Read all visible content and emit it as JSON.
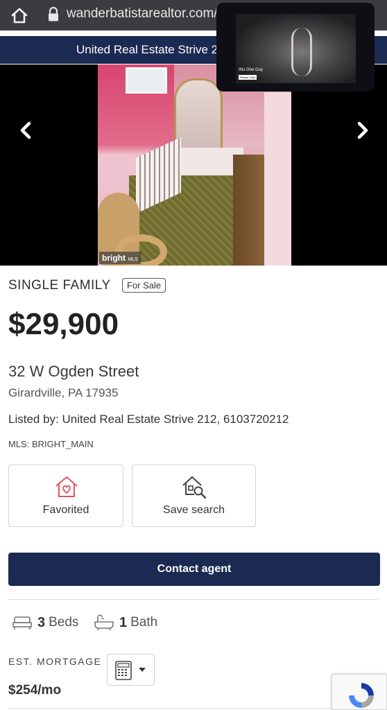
{
  "browser": {
    "url": "wanderbatistarealtor.com/"
  },
  "banner": {
    "text": "United Real Estate Strive 21"
  },
  "carousel": {
    "watermark": "bright",
    "watermark_sub": "MLS"
  },
  "pip_video": {
    "title": "this One Guy",
    "button": "Please Click"
  },
  "listing": {
    "property_type": "SINGLE FAMILY",
    "status": "For Sale",
    "price": "$29,900",
    "street": "32 W Ogden Street",
    "city_state_zip": "Girardville, PA 17935",
    "listed_by": "Listed by: United Real Estate Strive 212, 6103720212",
    "mls": "MLS: BRIGHT_MAIN"
  },
  "actions": {
    "favorite_label": "Favorited",
    "save_search_label": "Save search",
    "contact_label": "Contact agent"
  },
  "facts": {
    "beds_count": "3",
    "beds_label": "Beds",
    "baths_count": "1",
    "baths_label": "Bath"
  },
  "mortgage": {
    "label": "EST. MORTGAGE",
    "value": "$254/mo"
  },
  "colors": {
    "navy": "#1b2a52",
    "favorite_icon": "#e0555f",
    "url_bar": "#3c3c40"
  },
  "icons": {
    "home": "home-icon",
    "lock": "lock-icon",
    "prev": "chevron-left-icon",
    "next": "chevron-right-icon",
    "favorite": "heart-house-icon",
    "save_search": "house-search-icon",
    "bed": "bed-icon",
    "bath": "bathtub-icon",
    "calculator": "calculator-icon",
    "dropdown": "caret-down-icon",
    "recaptcha": "recaptcha-icon"
  }
}
